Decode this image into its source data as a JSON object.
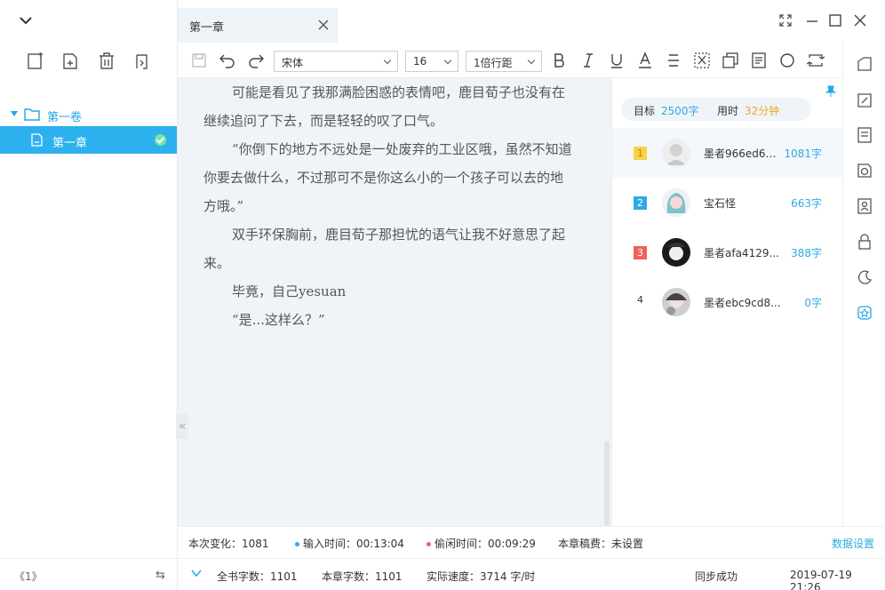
{
  "sidebar": {
    "volume_label": "第一卷",
    "chapter_label": "第一章",
    "page_indicator": "《1》"
  },
  "tab": {
    "title": "第一章"
  },
  "toolbar": {
    "font_family": "宋体",
    "font_size": "16",
    "line_spacing": "1倍行距"
  },
  "editor": {
    "paragraphs": [
      {
        "text": "可能是看见了我那满脸困惑的表情吧，鹿目荀子也没有在继续追问了下去，而是轻轻的叹了口气。"
      },
      {
        "text": "“你倒下的地方不远处是一处废弃的工业区哦，虽然不知道你要去做什么，不过那可不是你这么小的一个孩子可以去的地方哦。”"
      },
      {
        "text": "双手环保胸前，鹿目荀子那担忧的语气让我不好意思了起来。"
      },
      {
        "text": "毕竟，自己yesuan"
      },
      {
        "text": "“是...这样么？”"
      }
    ]
  },
  "panel": {
    "goal_label": "目标",
    "goal_value": "2500字",
    "time_label": "用时",
    "time_value": "32分钟",
    "ranking": [
      {
        "rank": "1",
        "name": "墨者966ed63...",
        "count": "1081字",
        "badge_color": "#f7d34a"
      },
      {
        "rank": "2",
        "name": "宝石怪",
        "count": "663字",
        "badge_color": "#2eaae4"
      },
      {
        "rank": "3",
        "name": "墨者afa4129...",
        "count": "388字",
        "badge_color": "#f0605d"
      },
      {
        "rank": "4",
        "name": "墨者ebc9cd8...",
        "count": "0字",
        "badge_color": ""
      }
    ]
  },
  "status": {
    "change": "本次变化：1081",
    "input_time": "输入时间：00:13:04",
    "idle_time": "偷闲时间：00:09:29",
    "fee": "本章稿费：未设置",
    "data_settings": "数据设置",
    "book_words": "全书字数：1101",
    "chapter_words": "本章字数：1101",
    "speed": "实际速度：3714 字/时",
    "sync": "同步成功",
    "datetime": "2019-07-19 21:26"
  },
  "colors": {
    "accent": "#2cb1ee",
    "input_dot": "#2eaae4",
    "idle_dot": "#f0605d",
    "time_value": "#f5a623"
  }
}
